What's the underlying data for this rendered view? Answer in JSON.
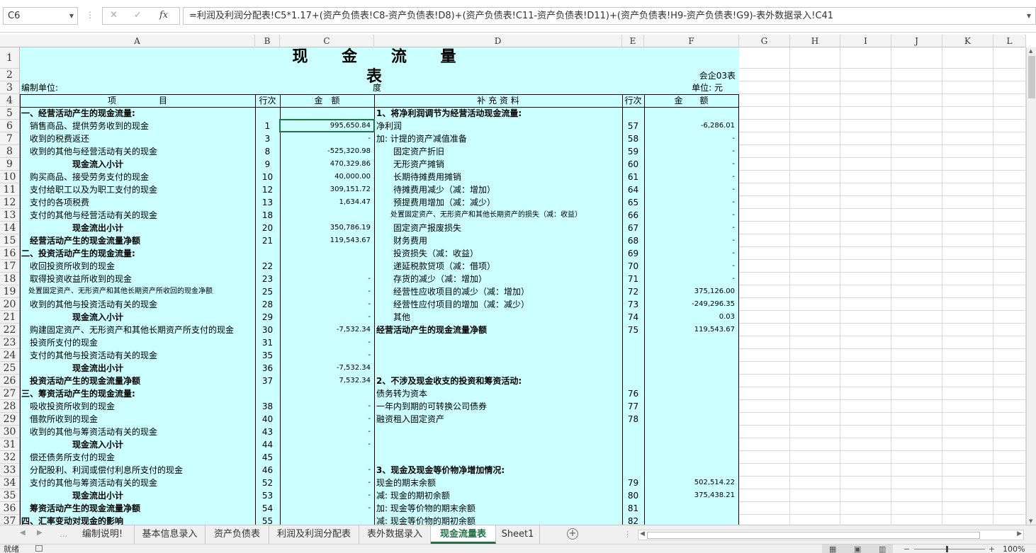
{
  "name_box": "C6",
  "formula": "=利润及利润分配表!C5*1.17+(资产负债表!C8-资产负债表!D8)+(资产负债表!C11-资产负债表!D11)+(资产负债表!H9-资产负债表!G9)-表外数据录入!C41",
  "columns": [
    "A",
    "B",
    "C",
    "D",
    "E",
    "F",
    "G",
    "H",
    "I",
    "J",
    "K",
    "L"
  ],
  "title": "现 金 流 量 表",
  "header": {
    "form_code": "会企03表",
    "unit_label": "编制单位:",
    "year": "度",
    "currency": "单位: 元",
    "col_item": "项　　　　　目",
    "col_line": "行次",
    "col_amount": "金　额",
    "col_supp": "补 充 资 料",
    "col_line2": "行次",
    "col_amount2": "金　　额"
  },
  "rows": [
    {
      "n": "1"
    },
    {
      "n": "2"
    },
    {
      "n": "3"
    },
    {
      "n": "4"
    },
    {
      "n": "5",
      "a": "一、经营活动产生的现金流量:",
      "ab": true,
      "d": "1、将净利润调节为经营活动现金流量:",
      "db": true
    },
    {
      "n": "6",
      "a": "　销售商品、提供劳务收到的现金",
      "b": "1",
      "c": "995,650.84",
      "d": "净利润",
      "e": "57",
      "f": "-6,286.01"
    },
    {
      "n": "7",
      "a": "　收到的税费返还",
      "b": "3",
      "c": "-",
      "d": "加: 计提的资产减值准备",
      "e": "58",
      "f": "-"
    },
    {
      "n": "8",
      "a": "　收到的其他与经营活动有关的现金",
      "b": "8",
      "c": "-525,320.98",
      "d": "　　固定资产折旧",
      "e": "59",
      "f": "-"
    },
    {
      "n": "9",
      "a": "　　　　　　现金流入小计",
      "ab": true,
      "b": "9",
      "c": "470,329.86",
      "d": "　　无形资产摊销",
      "e": "60",
      "f": "-"
    },
    {
      "n": "10",
      "a": "　购买商品、接受劳务支付的现金",
      "b": "10",
      "c": "40,000.00",
      "d": "　　长期待摊费用摊销",
      "e": "61",
      "f": "-"
    },
    {
      "n": "11",
      "a": "　支付给职工以及为职工支付的现金",
      "b": "12",
      "c": "309,151.72",
      "d": "　　待摊费用减少（减：增加）",
      "e": "64",
      "f": "-"
    },
    {
      "n": "12",
      "a": "　支付的各项税费",
      "b": "13",
      "c": "1,634.47",
      "d": "　　预提费用增加（减：减少）",
      "e": "65",
      "f": "-"
    },
    {
      "n": "13",
      "a": "　支付的其他与经营活动有关的现金",
      "b": "18",
      "c": "",
      "d": "　　处置固定资产、无形资产和其他长期资产的损失（减：收益）",
      "ds": true,
      "e": "66",
      "f": "-"
    },
    {
      "n": "14",
      "a": "　　　　　　现金流出小计",
      "ab": true,
      "b": "20",
      "c": "350,786.19",
      "d": "　　固定资产报废损失",
      "e": "67",
      "f": "-"
    },
    {
      "n": "15",
      "a": "　经营活动产生的现金流量净额",
      "ab": true,
      "b": "21",
      "c": "119,543.67",
      "d": "　　财务费用",
      "e": "68",
      "f": "-"
    },
    {
      "n": "16",
      "a": "二、投资活动产生的现金流量:",
      "ab": true,
      "d": "　　投资损失（减：收益）",
      "e": "69",
      "f": "-"
    },
    {
      "n": "17",
      "a": "　收回投资所收到的现金",
      "b": "22",
      "c": "",
      "d": "　　递延税款贷项（减：借项）",
      "e": "70",
      "f": "-"
    },
    {
      "n": "18",
      "a": "　取得投资收益所收到的现金",
      "b": "23",
      "c": "-",
      "d": "　　存货的减少（减：增加）",
      "e": "71",
      "f": "-"
    },
    {
      "n": "19",
      "a": "　处置固定资产、无形资产和其他长期资产所收回的现金净额",
      "as": true,
      "b": "25",
      "c": "-",
      "d": "　　经营性应收项目的减少（减：增加）",
      "e": "72",
      "f": "375,126.00"
    },
    {
      "n": "20",
      "a": "　收到的其他与投资活动有关的现金",
      "b": "28",
      "c": "-",
      "d": "　　经营性应付项目的增加（减：减少）",
      "e": "73",
      "f": "-249,296.35"
    },
    {
      "n": "21",
      "a": "　　　　　　现金流入小计",
      "ab": true,
      "b": "29",
      "c": "-",
      "d": "　　其他",
      "e": "74",
      "f": "0.03"
    },
    {
      "n": "22",
      "a": "　购建固定资产、无形资产和其他长期资产所支付的现金",
      "b": "30",
      "c": "-7,532.34",
      "d": "经营活动产生的现金流量净额",
      "db": true,
      "e": "75",
      "f": "119,543.67"
    },
    {
      "n": "23",
      "a": "　投资所支付的现金",
      "b": "31",
      "c": "-"
    },
    {
      "n": "24",
      "a": "　支付的其他与投资活动有关的现金",
      "b": "35",
      "c": "-"
    },
    {
      "n": "25",
      "a": "　　　　　　现金流出小计",
      "ab": true,
      "b": "36",
      "c": "-7,532.34"
    },
    {
      "n": "26",
      "a": "　投资活动产生的现金流量净额",
      "ab": true,
      "b": "37",
      "c": "7,532.34",
      "d": "2、不涉及现金收支的投资和筹资活动:",
      "db": true
    },
    {
      "n": "27",
      "a": "三、筹资活动产生的现金流量:",
      "ab": true,
      "d": "债务转为资本",
      "e": "76"
    },
    {
      "n": "28",
      "a": "　吸收投资所收到的现金",
      "b": "38",
      "c": "-",
      "d": "一年内到期的可转换公司债券",
      "e": "77"
    },
    {
      "n": "29",
      "a": "　借款所收到的现金",
      "b": "40",
      "c": "-",
      "d": "融资租入固定资产",
      "e": "78"
    },
    {
      "n": "30",
      "a": "　收到的其他与筹资活动有关的现金",
      "b": "43",
      "c": "-"
    },
    {
      "n": "31",
      "a": "　　　　　　现金流入小计",
      "ab": true,
      "b": "44",
      "c": "-"
    },
    {
      "n": "32",
      "a": "　偿还债务所支付的现金",
      "b": "45",
      "c": ""
    },
    {
      "n": "33",
      "a": "　分配股利、利润或偿付利息所支付的现金",
      "b": "46",
      "c": "-",
      "d": "3、现金及现金等价物净增加情况:",
      "db": true
    },
    {
      "n": "34",
      "a": "　支付的其他与筹资活动有关的现金",
      "b": "52",
      "c": "-",
      "d": "现金的期末余额",
      "e": "79",
      "f": "502,514.22"
    },
    {
      "n": "35",
      "a": "　　　　　　现金流出小计",
      "ab": true,
      "b": "53",
      "c": "-",
      "d": "减: 现金的期初余额",
      "e": "80",
      "f": "375,438.21"
    },
    {
      "n": "36",
      "a": "　筹资活动产生的现金流量净额",
      "ab": true,
      "b": "54",
      "c": "-",
      "d": "加: 现金等价物的期末余额",
      "e": "81"
    },
    {
      "n": "37",
      "a": "四、汇率变动对现金的影响",
      "ab": true,
      "b": "55",
      "c": "",
      "d": "减: 现金等价物的期初余额",
      "e": "82"
    }
  ],
  "tabs": [
    "编制说明!",
    "基本信息录入",
    "资产负债表",
    "利润及利润分配表",
    "表外数据录入",
    "现金流量表",
    "Sheet1"
  ],
  "active_tab": "现金流量表",
  "status": {
    "ready": "就绪",
    "zoom": "100%"
  },
  "colors": {
    "fill": "#ccffff",
    "accent": "#217346"
  },
  "icons": [
    "cancel-icon",
    "enter-icon",
    "function-icon",
    "add-sheet-icon",
    "page-layout-icon",
    "normal-view-icon"
  ]
}
